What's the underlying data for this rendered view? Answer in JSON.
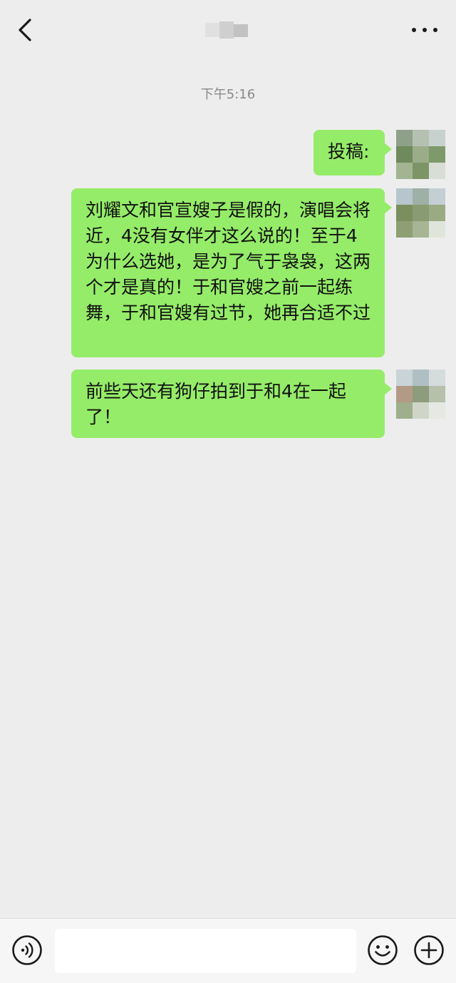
{
  "header": {
    "title": "",
    "back_icon": "chevron-left-icon",
    "more_icon": "more-dots-icon"
  },
  "chat": {
    "timestamp": "下午5:16",
    "messages": [
      {
        "sender": "self",
        "text": "投稿:"
      },
      {
        "sender": "self",
        "text": "刘耀文和官宣嫂子是假的，演唱会将近，4没有女伴才这么说的！至于4为什么选她，是为了气于袅袅，这两个才是真的！于和官嫂之前一起练舞，于和官嫂有过节，她再合适不过"
      },
      {
        "sender": "self",
        "text": "前些天还有狗仔拍到于和4在一起了！"
      }
    ]
  },
  "input_bar": {
    "voice_icon": "voice-icon",
    "input_value": "",
    "input_placeholder": "",
    "emoji_icon": "emoji-icon",
    "plus_icon": "plus-icon"
  },
  "colors": {
    "background": "#ededed",
    "bubble_self": "#95ec69",
    "bottom_bar": "#f6f6f6"
  }
}
